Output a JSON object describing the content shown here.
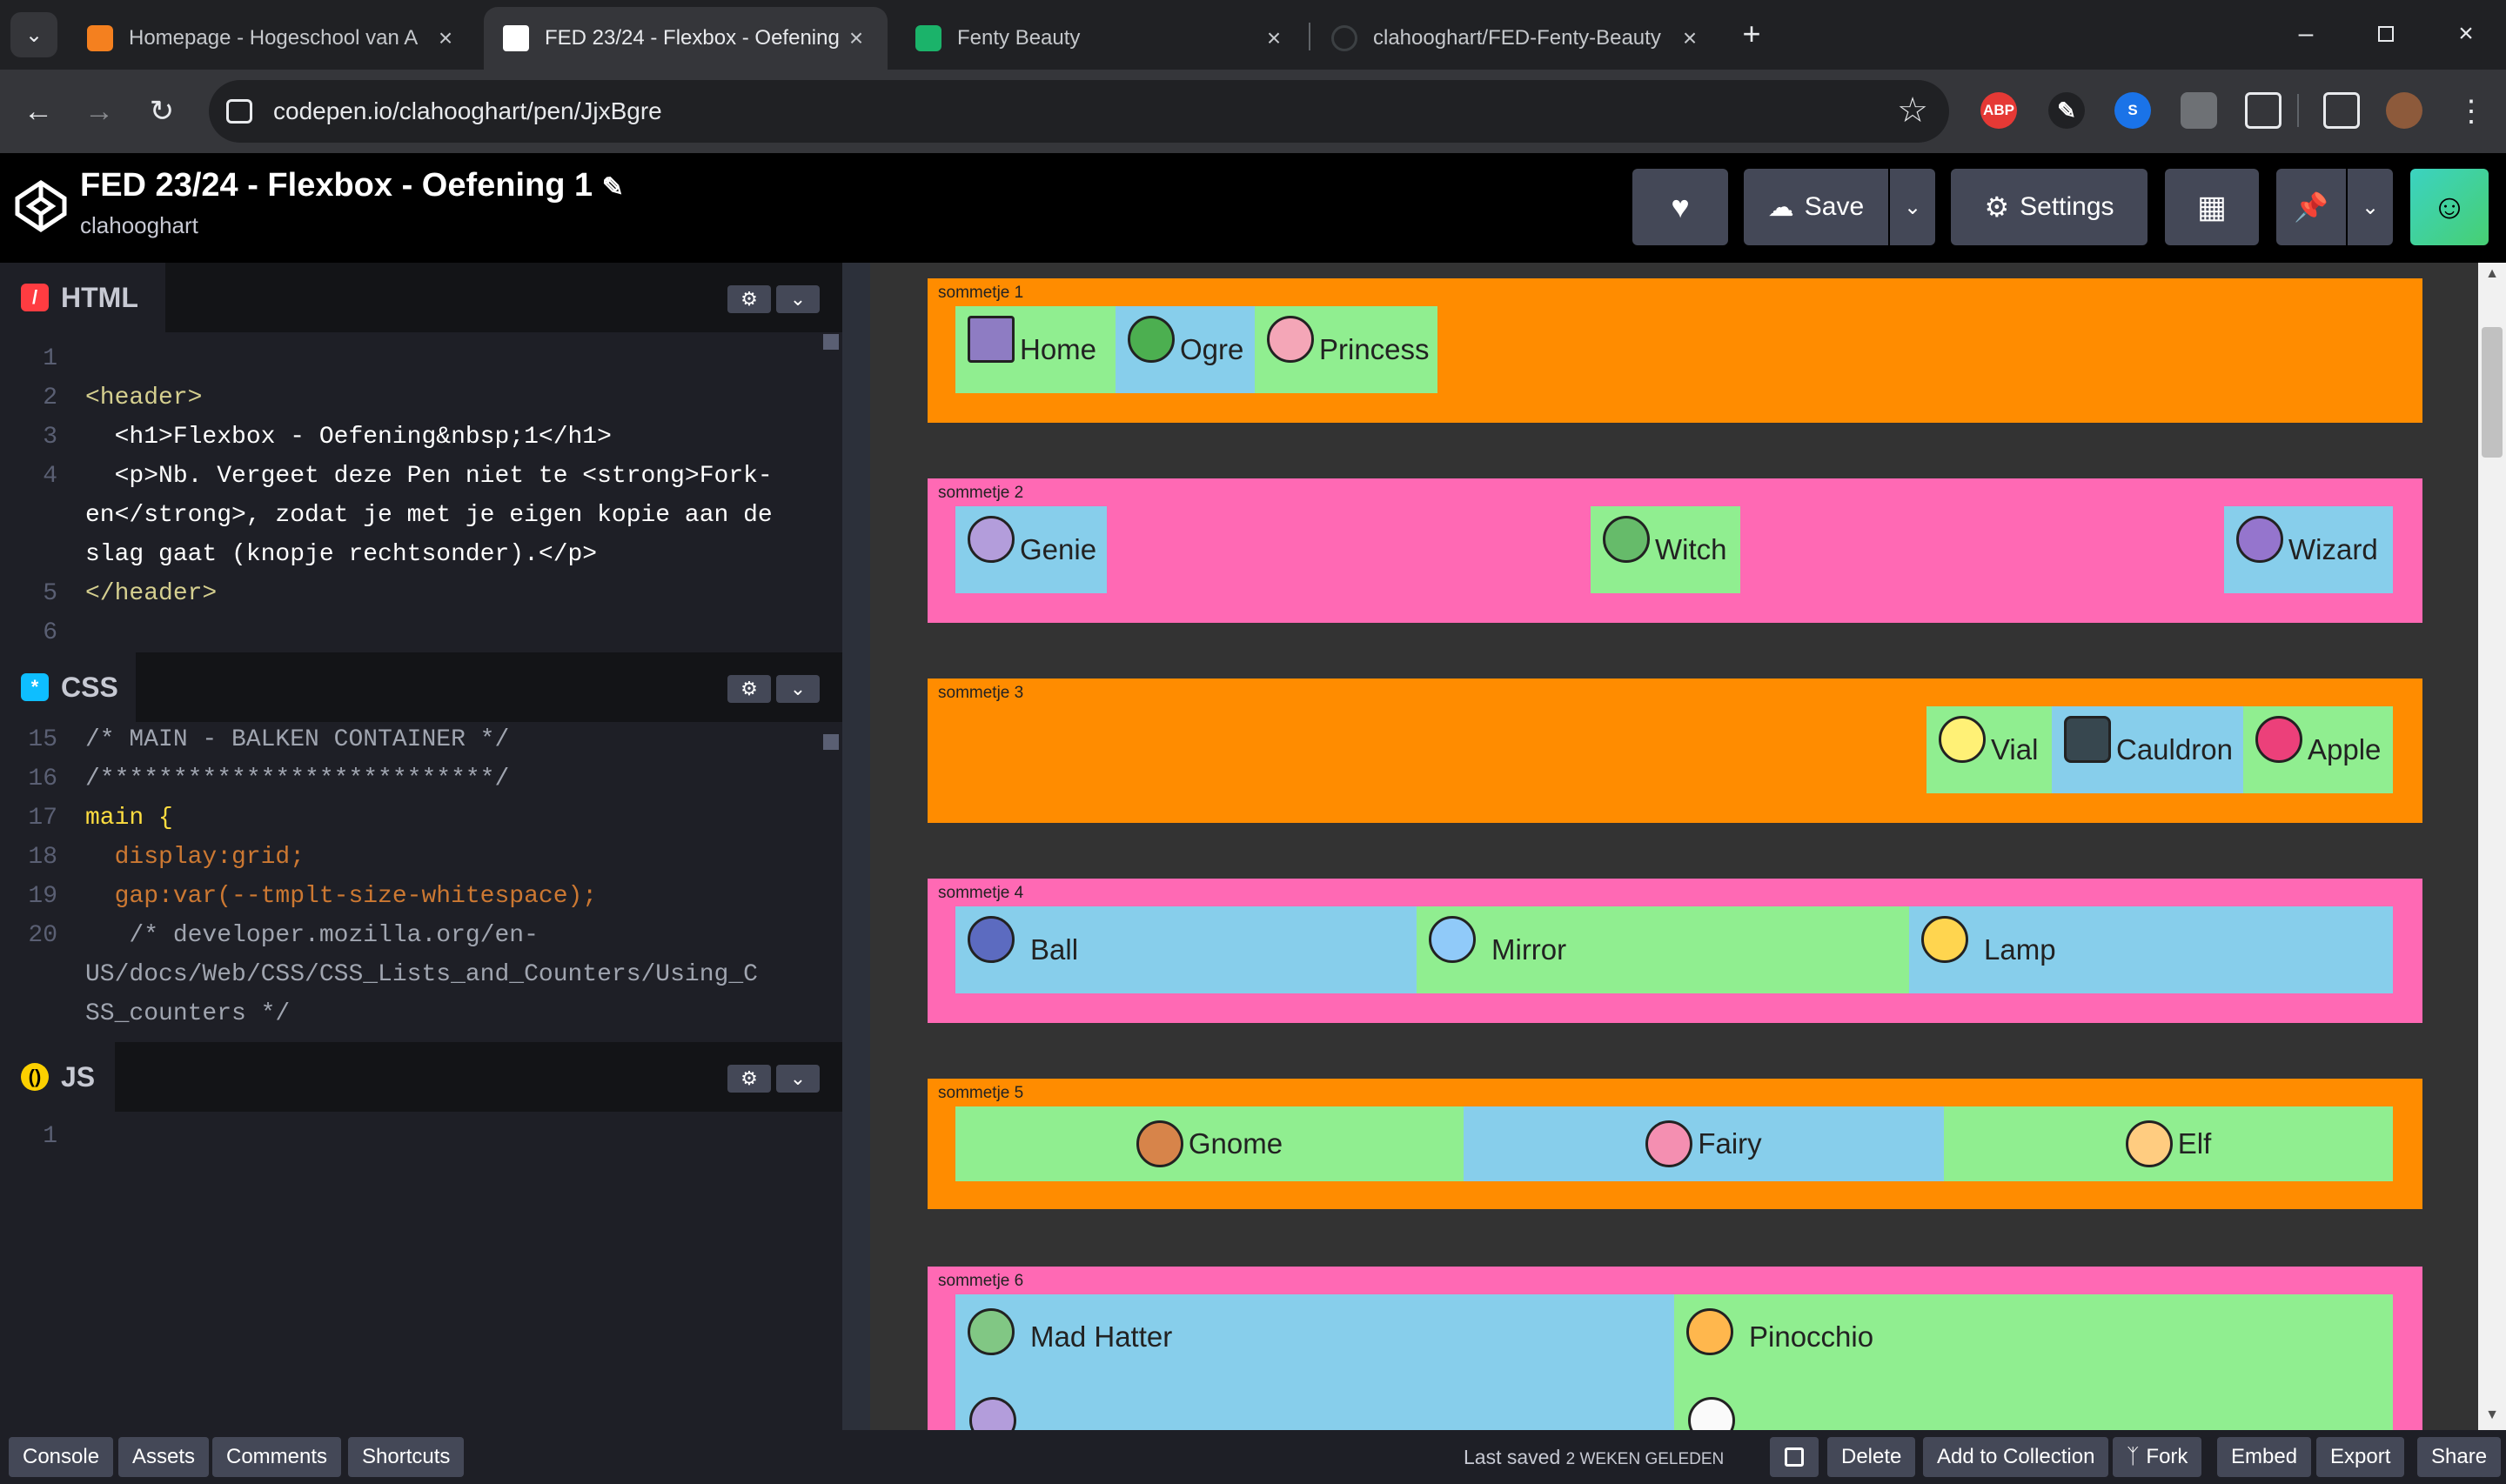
{
  "browser": {
    "tabs": [
      {
        "title": "Homepage - Hogeschool van A",
        "active": false
      },
      {
        "title": "FED 23/24 - Flexbox - Oefening",
        "active": true
      },
      {
        "title": "Fenty Beauty",
        "active": false
      },
      {
        "title": "clahooghart/FED-Fenty-Beauty",
        "active": false
      }
    ],
    "url": "codepen.io/clahooghart/pen/JjxBgre",
    "extensions": [
      "ABP"
    ]
  },
  "codepen": {
    "title": "FED 23/24 - Flexbox - Oefening 1",
    "user": "clahooghart",
    "save_label": "Save",
    "settings_label": "Settings"
  },
  "editors": {
    "html": {
      "label": "HTML",
      "line_numbers": [
        "1",
        "2",
        "3",
        "4",
        "",
        "",
        "5",
        "6"
      ],
      "lines": [
        "",
        "<header>",
        "  <h1>Flexbox - Oefening&nbsp;1</h1>",
        "  <p>Nb. Vergeet deze Pen niet te <strong>Fork-",
        "en</strong>, zodat je met je eigen kopie aan de",
        "slag gaat (knopje rechtsonder).</p>",
        "</header>",
        ""
      ]
    },
    "css": {
      "label": "CSS",
      "line_numbers": [
        "15",
        "16",
        "17",
        "18",
        "19",
        "20",
        "",
        ""
      ],
      "lines": [
        "/* MAIN - BALKEN CONTAINER */",
        "/***************************/",
        "main {",
        "  display:grid;",
        "  gap:var(--tmplt-size-whitespace);",
        "   /* developer.mozilla.org/en-",
        "US/docs/Web/CSS/CSS_Lists_and_Counters/Using_C",
        "SS_counters */"
      ]
    },
    "js": {
      "label": "JS",
      "line_numbers": [
        "1"
      ]
    }
  },
  "preview": {
    "boxes": [
      {
        "label": "sommetje 1",
        "items": [
          "Home",
          "Ogre",
          "Princess"
        ]
      },
      {
        "label": "sommetje 2",
        "items": [
          "Genie",
          "Witch",
          "Wizard"
        ]
      },
      {
        "label": "sommetje 3",
        "items": [
          "Vial",
          "Cauldron",
          "Apple"
        ]
      },
      {
        "label": "sommetje 4",
        "items": [
          "Ball",
          "Mirror",
          "Lamp"
        ]
      },
      {
        "label": "sommetje 5",
        "items": [
          "Gnome",
          "Fairy",
          "Elf"
        ]
      },
      {
        "label": "sommetje 6",
        "items": [
          "Mad Hatter",
          "Pinocchio"
        ]
      }
    ]
  },
  "footer": {
    "console": "Console",
    "assets": "Assets",
    "comments": "Comments",
    "shortcuts": "Shortcuts",
    "last_saved_prefix": "Last saved",
    "last_saved_time": "2 WEKEN GELEDEN",
    "delete": "Delete",
    "add_to_collection": "Add to Collection",
    "fork": "Fork",
    "embed": "Embed",
    "export": "Export",
    "share": "Share"
  }
}
